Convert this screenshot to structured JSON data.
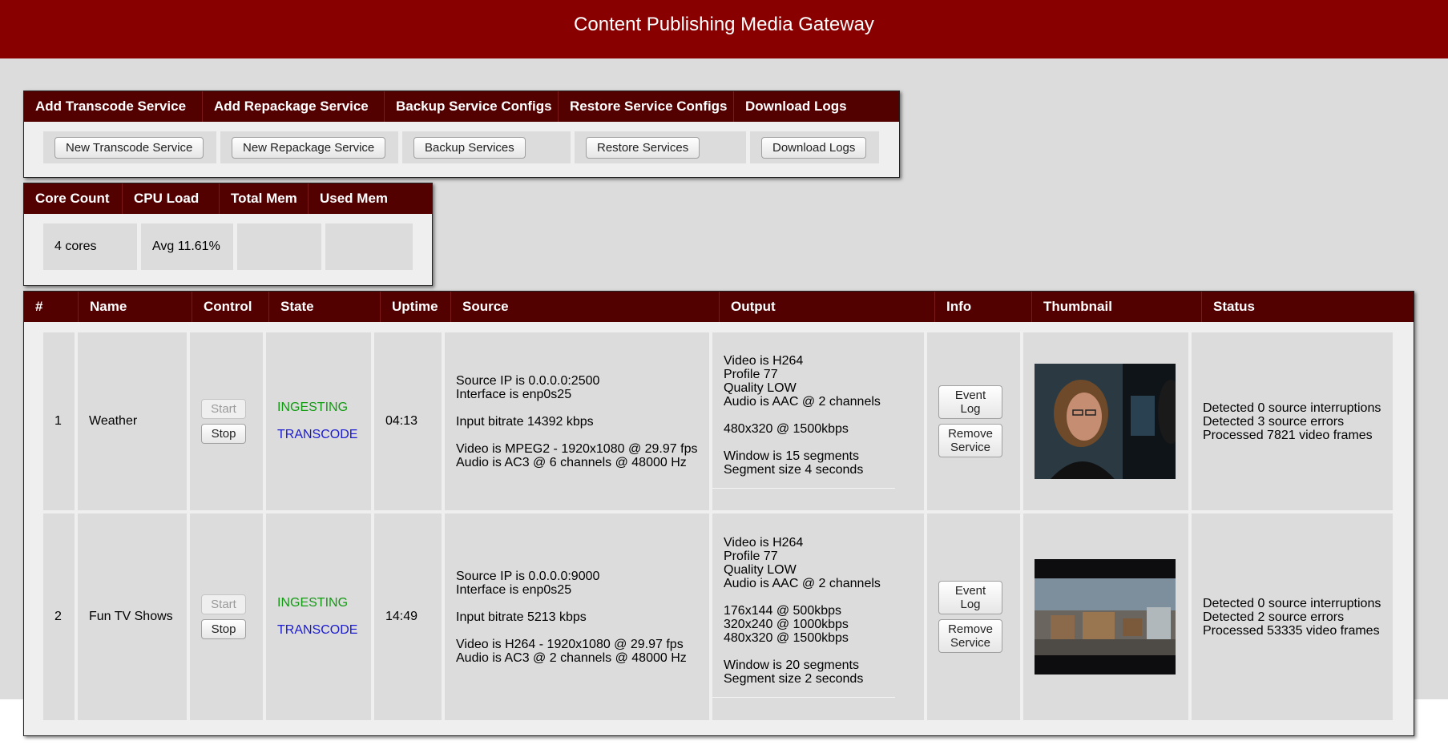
{
  "header": {
    "title": "Content Publishing Media Gateway"
  },
  "actions": {
    "headers": [
      "Add Transcode Service",
      "Add Repackage Service",
      "Backup Service Configs",
      "Restore Service Configs",
      "Download Logs"
    ],
    "buttons": [
      "New Transcode Service",
      "New Repackage Service",
      "Backup Services",
      "Restore Services",
      "Download Logs"
    ]
  },
  "stats": {
    "headers": [
      "Core Count",
      "CPU Load",
      "Total Mem",
      "Used Mem"
    ],
    "values": [
      "4 cores",
      "Avg 11.61%",
      "",
      ""
    ]
  },
  "services": {
    "headers": [
      "#",
      "Name",
      "Control",
      "State",
      "Uptime",
      "Source",
      "Output",
      "Info",
      "Thumbnail",
      "Status"
    ],
    "start_label": "Start",
    "stop_label": "Stop",
    "event_log_label": "Event\nLog",
    "remove_label": "Remove\nService",
    "rows": [
      {
        "num": "1",
        "name": "Weather",
        "state_ingest": "INGESTING",
        "state_mode": "TRANSCODE",
        "uptime": "04:13",
        "source": "Source IP is 0.0.0.0:2500\nInterface is enp0s25\n\nInput bitrate 14392 kbps\n\nVideo is MPEG2 - 1920x1080 @ 29.97 fps\nAudio is AC3 @ 6 channels @ 48000 Hz",
        "output": "Video is H264\nProfile 77\nQuality LOW\nAudio is AAC @ 2 channels\n\n480x320 @ 1500kbps\n\nWindow is 15 segments\nSegment size 4 seconds",
        "status": "Detected 0 source interruptions\nDetected 3 source errors\nProcessed 7821 video frames"
      },
      {
        "num": "2",
        "name": "Fun TV Shows",
        "state_ingest": "INGESTING",
        "state_mode": "TRANSCODE",
        "uptime": "14:49",
        "source": "Source IP is 0.0.0.0:9000\nInterface is enp0s25\n\nInput bitrate 5213 kbps\n\nVideo is H264 - 1920x1080 @ 29.97 fps\nAudio is AC3 @ 2 channels @ 48000 Hz",
        "output": "Video is H264\nProfile 77\nQuality LOW\nAudio is AAC @ 2 channels\n\n176x144 @ 500kbps\n320x240 @ 1000kbps\n480x320 @ 1500kbps\n\nWindow is 20 segments\nSegment size 2 seconds",
        "status": "Detected 0 source interruptions\nDetected 2 source errors\nProcessed 53335 video frames"
      }
    ]
  }
}
